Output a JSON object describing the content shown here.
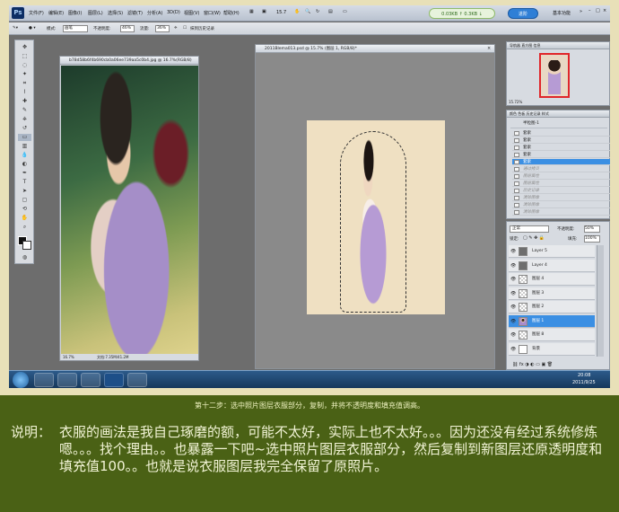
{
  "menubar": {
    "app_logo": "Ps",
    "items": [
      "文件(F)",
      "编辑(E)",
      "图像(I)",
      "图层(L)",
      "选择(S)",
      "滤镜(T)",
      "分析(A)",
      "3D(D)",
      "视图(V)",
      "窗口(W)",
      "帮助(H)"
    ],
    "zoom": "15.7",
    "net_speed": "0.03KB ↑  0.3KB ↓",
    "jump_label": "进阶",
    "workspace": "基本功能"
  },
  "options": {
    "mode_label": "模式:",
    "mode_value": "画笔",
    "opacity_label": "不透明度:",
    "opacity_value": "46%",
    "flow_label": "流量:",
    "flow_value": "36%",
    "history_label": "抹到历史记录"
  },
  "doc_left": {
    "title": "b78d58b6f4b690cb0a06ee739aa5c0b4.jpg @ 16.7%(RGB/8)",
    "status_zoom": "16.7%",
    "status_doc": "文档:7.35M/41.2M"
  },
  "doc_right": {
    "title": "2011Blema013.psd @ 15.7% (图层 1, RGB/8)*"
  },
  "navigator": {
    "tabs": "导航器  直方图  信息",
    "zoom": "15.72%"
  },
  "history": {
    "tabs": "颜色  色板  历史记录  样式",
    "snapshot": "半粒图-1",
    "rows": [
      {
        "label": "套索",
        "state": "normal"
      },
      {
        "label": "套索",
        "state": "normal"
      },
      {
        "label": "套索",
        "state": "normal"
      },
      {
        "label": "套索",
        "state": "normal"
      },
      {
        "label": "套索",
        "state": "selected"
      },
      {
        "label": "通过拷贝",
        "state": "dim"
      },
      {
        "label": "图层属性",
        "state": "dim"
      },
      {
        "label": "图层属性",
        "state": "dim"
      },
      {
        "label": "历史记录",
        "state": "dim"
      },
      {
        "label": "清除图像",
        "state": "dim"
      },
      {
        "label": "清除图像",
        "state": "dim"
      },
      {
        "label": "清除图像",
        "state": "dim"
      }
    ]
  },
  "layers": {
    "blend_mode": "正常",
    "opacity_label": "不透明度:",
    "opacity_value": "50%",
    "lock_label": "锁定:",
    "fill_label": "填充:",
    "fill_value": "100%",
    "rows": [
      {
        "name": "Layer 5",
        "thumb": "gray",
        "selected": false
      },
      {
        "name": "Layer 4",
        "thumb": "gray",
        "selected": false
      },
      {
        "name": "图层 4",
        "thumb": "check",
        "selected": false
      },
      {
        "name": "图层 3",
        "thumb": "check",
        "selected": false
      },
      {
        "name": "图层 2",
        "thumb": "check",
        "selected": false
      },
      {
        "name": "图层 1",
        "thumb": "girl",
        "selected": true
      },
      {
        "name": "图层 8",
        "thumb": "check",
        "selected": false
      },
      {
        "name": "背景",
        "thumb": "white",
        "selected": false
      }
    ]
  },
  "taskbar": {
    "time": "20:08",
    "date": "2011/9/25"
  },
  "caption": "第十二步：选中照片图层衣服部分，复制，并将不透明度和填充值调高。",
  "description": {
    "label": "说明：",
    "body": "衣服的画法是我自己琢磨的额，可能不太好，实际上也不太好。。。因为还没有经过系统修炼嗯。。。找个理由。。也暴露一下吧~选中照片图层衣服部分，然后复制到新图层还原透明度和填充值100。。也就是说衣服图层我完全保留了原照片。"
  },
  "colors": {
    "bottom_bg": "#4a6115",
    "frame_bg": "#e8e0b8",
    "selection_blue": "#3b8fe3"
  }
}
